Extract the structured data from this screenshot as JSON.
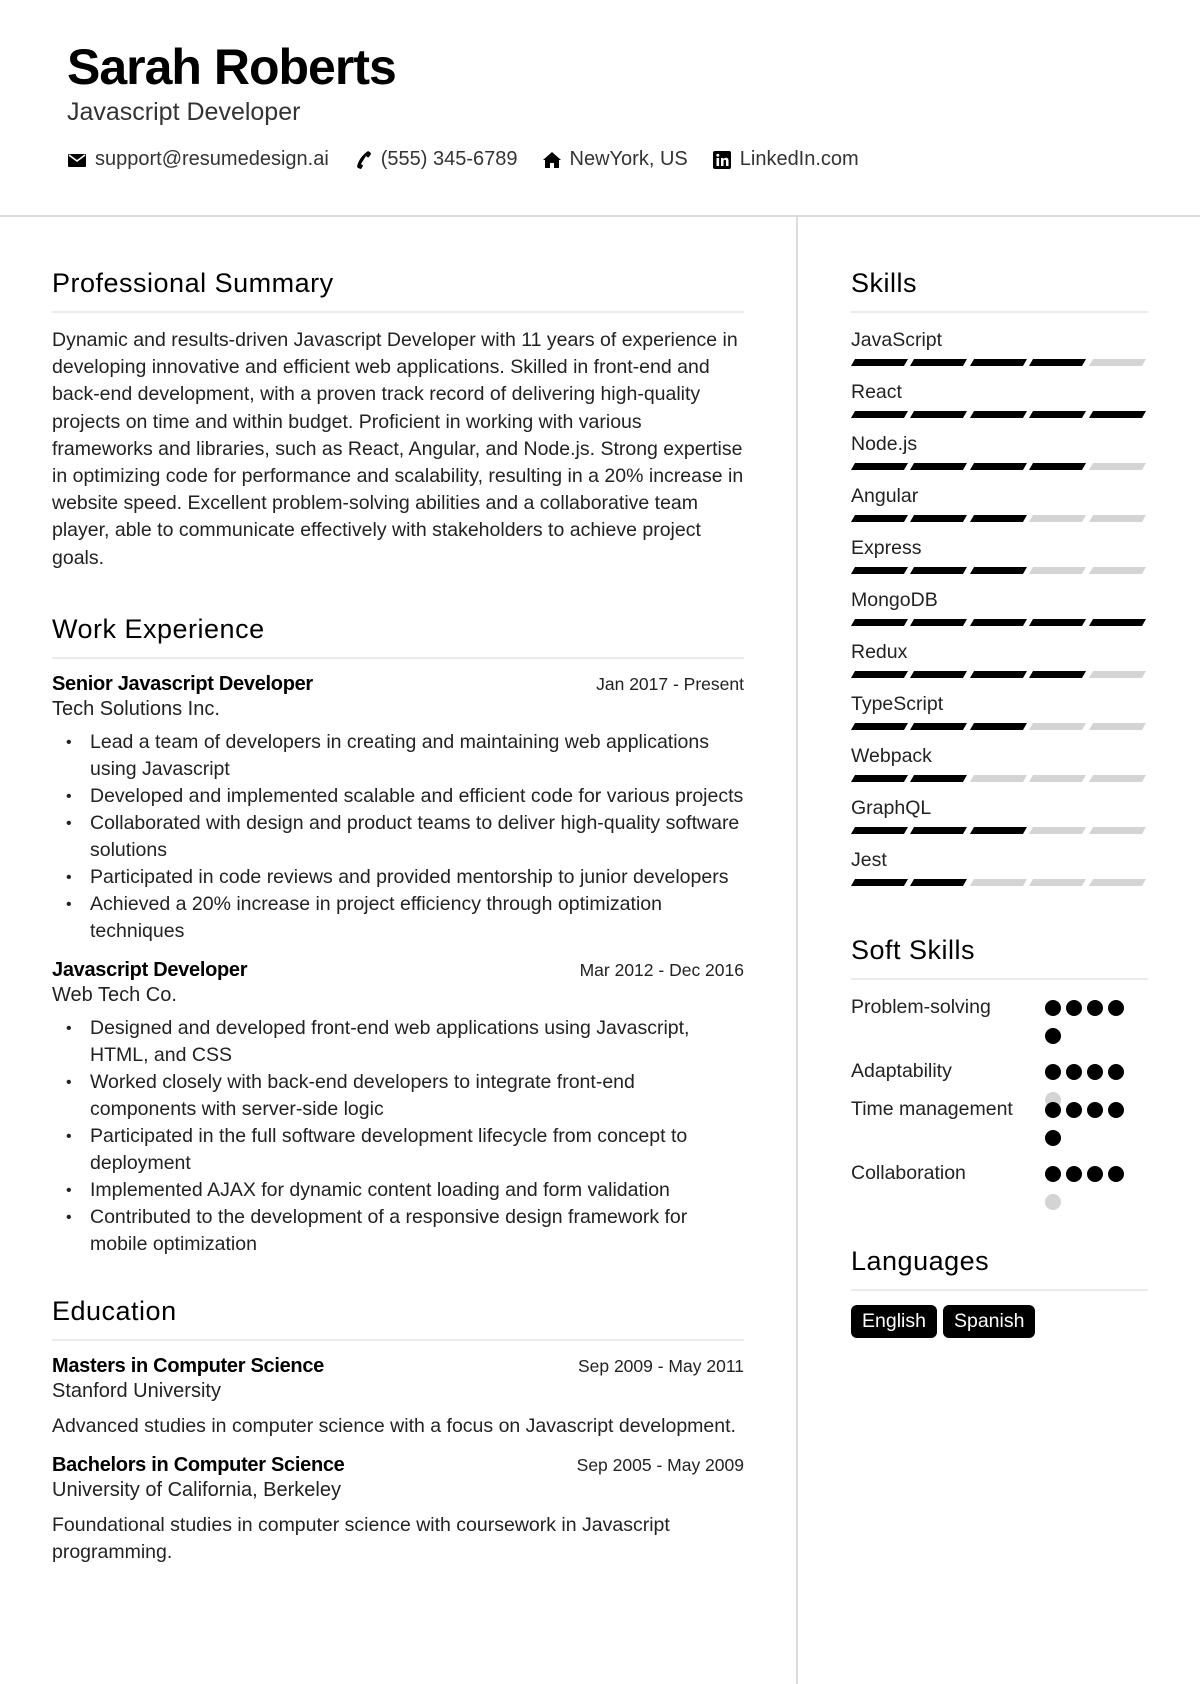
{
  "header": {
    "name": "Sarah Roberts",
    "title": "Javascript Developer",
    "contacts": [
      {
        "icon": "envelope-icon",
        "text": "support@resumedesign.ai"
      },
      {
        "icon": "phone-icon",
        "text": "(555) 345-6789"
      },
      {
        "icon": "home-icon",
        "text": "NewYork, US"
      },
      {
        "icon": "linkedin-icon",
        "text": "LinkedIn.com"
      }
    ]
  },
  "summary": {
    "heading": "Professional Summary",
    "text": "Dynamic and results-driven Javascript Developer with 11 years of experience in developing innovative and efficient web applications. Skilled in front-end and back-end development, with a proven track record of delivering high-quality projects on time and within budget. Proficient in working with various frameworks and libraries, such as React, Angular, and Node.js. Strong expertise in optimizing code for performance and scalability, resulting in a 20% increase in website speed. Excellent problem-solving abilities and a collaborative team player, able to communicate effectively with stakeholders to achieve project goals."
  },
  "experience": {
    "heading": "Work Experience",
    "jobs": [
      {
        "role": "Senior Javascript Developer",
        "dates": "Jan 2017 - Present",
        "company": "Tech Solutions Inc.",
        "bullets": [
          "Lead a team of developers in creating and maintaining web applications using Javascript",
          "Developed and implemented scalable and efficient code for various projects",
          "Collaborated with design and product teams to deliver high-quality software solutions",
          "Participated in code reviews and provided mentorship to junior developers",
          "Achieved a 20% increase in project efficiency through optimization techniques"
        ]
      },
      {
        "role": "Javascript Developer",
        "dates": "Mar 2012 - Dec 2016",
        "company": "Web Tech Co.",
        "bullets": [
          "Designed and developed front-end web applications using Javascript, HTML, and CSS",
          "Worked closely with back-end developers to integrate front-end components with server-side logic",
          "Participated in the full software development lifecycle from concept to deployment",
          "Implemented AJAX for dynamic content loading and form validation",
          "Contributed to the development of a responsive design framework for mobile optimization"
        ]
      }
    ]
  },
  "education": {
    "heading": "Education",
    "items": [
      {
        "degree": "Masters in Computer Science",
        "dates": "Sep 2009 - May 2011",
        "school": "Stanford University",
        "description": "Advanced studies in computer science with a focus on Javascript development."
      },
      {
        "degree": "Bachelors in Computer Science",
        "dates": "Sep 2005 - May 2009",
        "school": "University of California, Berkeley",
        "description": "Foundational studies in computer science with coursework in Javascript programming."
      }
    ]
  },
  "skills": {
    "heading": "Skills",
    "max_level": 5,
    "items": [
      {
        "name": "JavaScript",
        "level": 4
      },
      {
        "name": "React",
        "level": 5
      },
      {
        "name": "Node.js",
        "level": 4
      },
      {
        "name": "Angular",
        "level": 3
      },
      {
        "name": "Express",
        "level": 3
      },
      {
        "name": "MongoDB",
        "level": 5
      },
      {
        "name": "Redux",
        "level": 4
      },
      {
        "name": "TypeScript",
        "level": 3
      },
      {
        "name": "Webpack",
        "level": 2
      },
      {
        "name": "GraphQL",
        "level": 3
      },
      {
        "name": "Jest",
        "level": 2
      }
    ]
  },
  "soft_skills": {
    "heading": "Soft Skills",
    "max_level": 5,
    "items": [
      {
        "name": "Problem-solving",
        "level": 5
      },
      {
        "name": "Adaptability",
        "level": 4
      },
      {
        "name": "Time management",
        "level": 5
      },
      {
        "name": "Collaboration",
        "level": 4
      }
    ]
  },
  "languages": {
    "heading": "Languages",
    "items": [
      "English",
      "Spanish"
    ]
  },
  "colors": {
    "accent": "#000000",
    "inactive": "#d4d4d4",
    "divider": "#dcdcdc"
  }
}
